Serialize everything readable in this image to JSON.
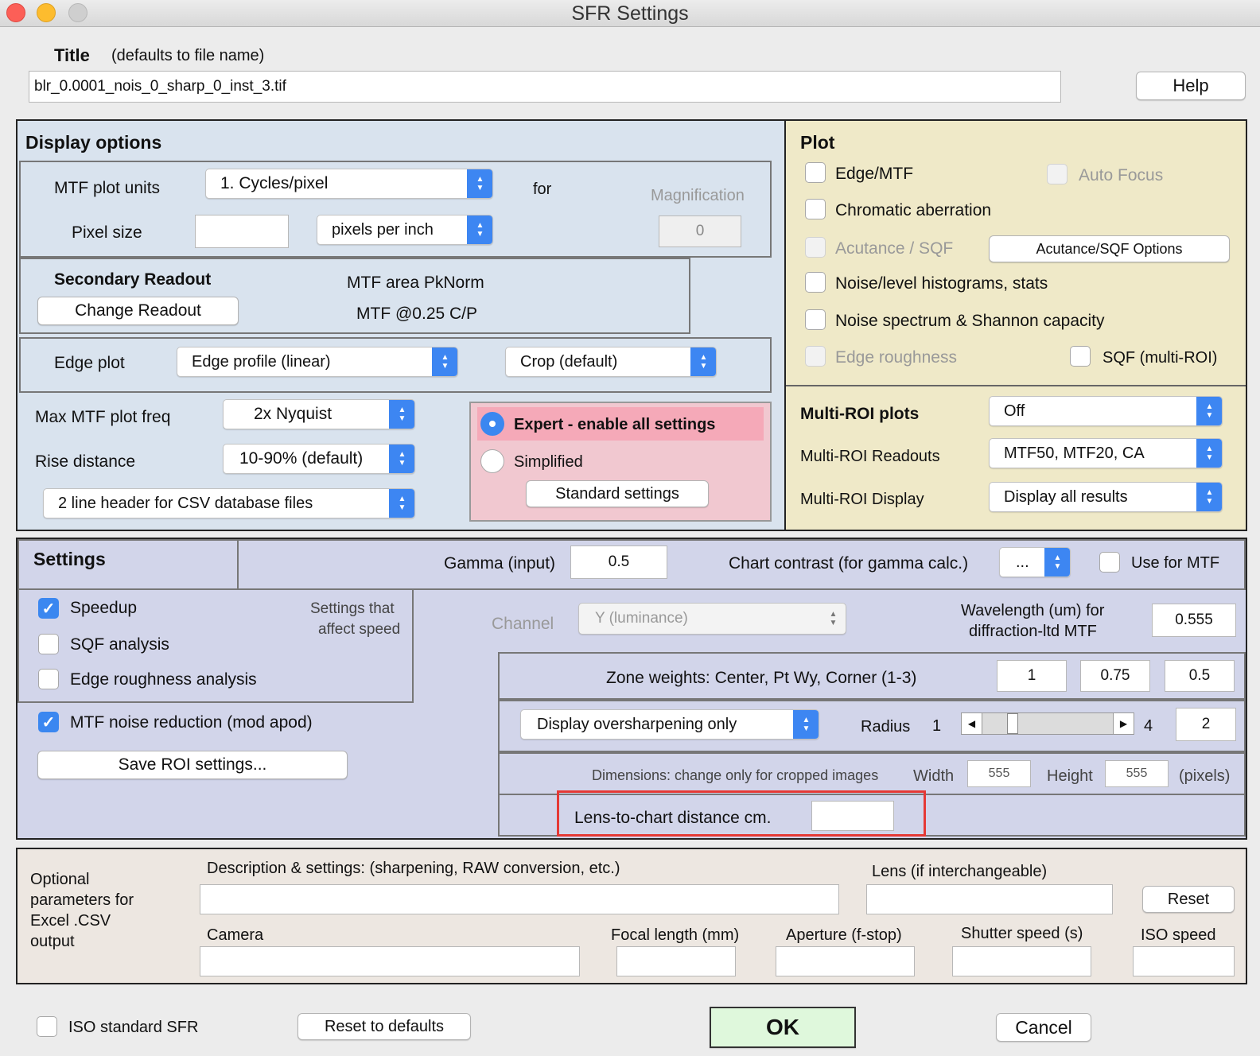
{
  "window": {
    "title": "SFR Settings"
  },
  "title_field": {
    "label": "Title",
    "hint": "(defaults to file name)",
    "value": "blr_0.0001_nois_0_sharp_0_inst_3.tif"
  },
  "help_label": "Help",
  "display": {
    "heading": "Display options",
    "mtf_units_label": "MTF plot units",
    "mtf_units_value": "1. Cycles/pixel",
    "for_label": "for",
    "magnification_label": "Magnification",
    "magnification_value": "0",
    "pixel_size_label": "Pixel size",
    "pixel_size_value": "",
    "pixel_units_value": "pixels per inch",
    "secondary_heading": "Secondary Readout",
    "change_readout_label": "Change Readout",
    "readout_1": "MTF area PkNorm",
    "readout_2": "MTF @0.25 C/P",
    "edge_plot_label": "Edge plot",
    "edge_plot_value": "Edge profile (linear)",
    "crop_value": "Crop (default)",
    "max_freq_label": "Max MTF plot freq",
    "max_freq_value": "2x Nyquist",
    "rise_label": "Rise distance",
    "rise_value": "10-90% (default)",
    "csv_header_value": "2 line header for CSV database files",
    "expert_label": "Expert - enable all settings",
    "simplified_label": "Simplified",
    "standard_settings_label": "Standard settings"
  },
  "plot": {
    "heading": "Plot",
    "edge_mtf": "Edge/MTF",
    "auto_focus": "Auto Focus",
    "chromatic": "Chromatic aberration",
    "acutance": "Acutance / SQF",
    "acutance_options": "Acutance/SQF Options",
    "noise_hist": "Noise/level histograms, stats",
    "noise_spectrum": "Noise spectrum & Shannon capacity",
    "edge_roughness": "Edge roughness",
    "sqf_multi": "SQF (multi-ROI)",
    "multi_heading": "Multi-ROI plots",
    "multi_plots_value": "Off",
    "multi_readouts_label": "Multi-ROI Readouts",
    "multi_readouts_value": "MTF50, MTF20, CA",
    "multi_display_label": "Multi-ROI Display",
    "multi_display_value": "Display all results"
  },
  "settings": {
    "heading": "Settings",
    "gamma_label": "Gamma (input)",
    "gamma_value": "0.5",
    "chart_contrast_label": "Chart contrast (for gamma calc.)",
    "chart_contrast_value": "...",
    "use_for_mtf": "Use for MTF",
    "speedup": "Speedup",
    "speed_note_1": "Settings that",
    "speed_note_2": "affect speed",
    "sqf_analysis": "SQF analysis",
    "edge_roughness_analysis": "Edge roughness analysis",
    "mtf_noise": "MTF noise reduction (mod apod)",
    "save_roi": "Save ROI settings...",
    "channel_label": "Channel",
    "channel_value": "Y (luminance)",
    "wavelength_label_1": "Wavelength (um) for",
    "wavelength_label_2": "diffraction-ltd MTF",
    "wavelength_value": "0.555",
    "zone_label": "Zone weights:  Center, Pt Wy, Corner (1-3)",
    "zone_values": [
      "1",
      "0.75",
      "0.5"
    ],
    "oversharpen_value": "Display oversharpening only",
    "radius_label": "Radius",
    "radius_min": "1",
    "radius_max": "4",
    "radius_value": "2",
    "radius_fraction": 0.2,
    "dimensions_label": "Dimensions: change only for cropped images",
    "width_label": "Width",
    "width_value": "555",
    "height_label": "Height",
    "height_value": "555",
    "pixels_label": "(pixels)",
    "lens_distance_label": "Lens-to-chart distance cm.",
    "lens_distance_value": ""
  },
  "optional": {
    "side_label_1": "Optional",
    "side_label_2": "parameters for",
    "side_label_3": "Excel .CSV",
    "side_label_4": "output",
    "description_label": "Description & settings:  (sharpening, RAW conversion, etc.)",
    "lens_label": "Lens (if interchangeable)",
    "reset_label": "Reset",
    "camera_label": "Camera",
    "focal_label": "Focal length (mm)",
    "aperture_label": "Aperture (f-stop)",
    "shutter_label": "Shutter speed (s)",
    "iso_label": "ISO speed"
  },
  "footer": {
    "iso_standard": "ISO standard SFR",
    "reset_defaults": "Reset to defaults",
    "ok": "OK",
    "cancel": "Cancel"
  },
  "colors": {
    "display_bg": "#d9e3ee",
    "plot_bg": "#efe9c8",
    "settings_bg": "#d2d5ea",
    "optional_bg": "#ede7e1",
    "expert_bg": "#f1c8d0",
    "accent": "#3b87f0",
    "highlight": "#e53935"
  }
}
